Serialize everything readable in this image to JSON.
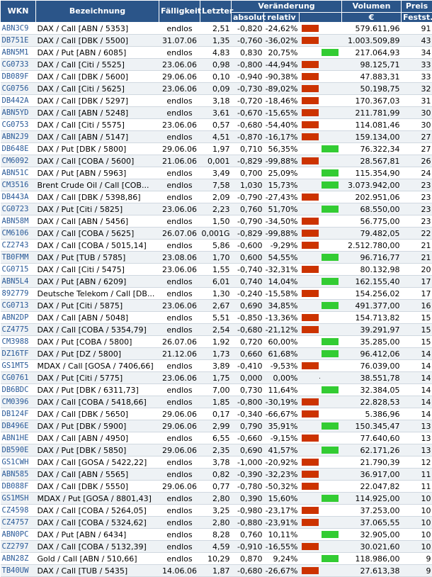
{
  "header": {
    "wkn": "WKN",
    "bezeichnung": "Bezeichnung",
    "faelligkeit": "Fälligkeit",
    "letzter": "Letzter",
    "veraenderung": "Veränderung",
    "absolut": "absolut",
    "relativ": "relativ",
    "volumen": "Volumen",
    "volumen_unit": "€",
    "preis": "Preis",
    "feststellungen": "Festst."
  },
  "colors": {
    "header_bg": "#2b5589",
    "negative_bar": "#cc3300",
    "positive_bar": "#33cc33",
    "link": "#2a5a98"
  },
  "rows": [
    {
      "wkn": "ABN3C9",
      "name": "DAX / Call [ABN / 5353]",
      "due": "endlos",
      "last": "2,51",
      "abs": "-0,820",
      "rel": "-24,62%",
      "dir": "neg",
      "vol": "579.611,96",
      "cnt": "91"
    },
    {
      "wkn": "DB751E",
      "name": "DAX / Call [DBK / 5500]",
      "due": "31.07.06",
      "last": "1,35",
      "abs": "-0,760",
      "rel": "-36,02%",
      "dir": "neg",
      "vol": "1.003.509,89",
      "cnt": "43"
    },
    {
      "wkn": "ABN5M1",
      "name": "DAX / Put [ABN / 6085]",
      "due": "endlos",
      "last": "4,83",
      "abs": "0,830",
      "rel": "20,75%",
      "dir": "pos",
      "vol": "217.064,93",
      "cnt": "34"
    },
    {
      "wkn": "CG0733",
      "name": "DAX / Call [Citi / 5525]",
      "due": "23.06.06",
      "last": "0,98",
      "abs": "-0,800",
      "rel": "-44,94%",
      "dir": "neg",
      "vol": "98.125,71",
      "cnt": "33"
    },
    {
      "wkn": "DB089F",
      "name": "DAX / Call [DBK / 5600]",
      "due": "29.06.06",
      "last": "0,10",
      "abs": "-0,940",
      "rel": "-90,38%",
      "dir": "neg",
      "vol": "47.883,31",
      "cnt": "33"
    },
    {
      "wkn": "CG0756",
      "name": "DAX / Call [Citi / 5625]",
      "due": "23.06.06",
      "last": "0,09",
      "abs": "-0,730",
      "rel": "-89,02%",
      "dir": "neg",
      "vol": "50.198,75",
      "cnt": "32"
    },
    {
      "wkn": "DB442A",
      "name": "DAX / Call [DBK / 5297]",
      "due": "endlos",
      "last": "3,18",
      "abs": "-0,720",
      "rel": "-18,46%",
      "dir": "neg",
      "vol": "170.367,03",
      "cnt": "31"
    },
    {
      "wkn": "ABN5YD",
      "name": "DAX / Call [ABN / 5248]",
      "due": "endlos",
      "last": "3,61",
      "abs": "-0,670",
      "rel": "-15,65%",
      "dir": "neg",
      "vol": "211.781,99",
      "cnt": "30"
    },
    {
      "wkn": "CG0753",
      "name": "DAX / Call [Citi / 5575]",
      "due": "23.06.06",
      "last": "0,57",
      "abs": "-0,680",
      "rel": "-54,40%",
      "dir": "neg",
      "vol": "114.081,46",
      "cnt": "30"
    },
    {
      "wkn": "ABN2J9",
      "name": "DAX / Call [ABN / 5147]",
      "due": "endlos",
      "last": "4,51",
      "abs": "-0,870",
      "rel": "-16,17%",
      "dir": "neg",
      "vol": "159.134,00",
      "cnt": "27"
    },
    {
      "wkn": "DB648E",
      "name": "DAX / Put [DBK / 5800]",
      "due": "29.06.06",
      "last": "1,97",
      "abs": "0,710",
      "rel": "56,35%",
      "dir": "pos",
      "vol": "76.322,34",
      "cnt": "27"
    },
    {
      "wkn": "CM6092",
      "name": "DAX / Call [COBA / 5600]",
      "due": "21.06.06",
      "last": "0,001",
      "abs": "-0,829",
      "rel": "-99,88%",
      "dir": "neg",
      "vol": "28.567,81",
      "cnt": "26"
    },
    {
      "wkn": "ABN51C",
      "name": "DAX / Put [ABN / 5963]",
      "due": "endlos",
      "last": "3,49",
      "abs": "0,700",
      "rel": "25,09%",
      "dir": "pos",
      "vol": "115.354,90",
      "cnt": "24"
    },
    {
      "wkn": "CM3516",
      "name": "Brent Crude Oil / Call [COB...",
      "due": "endlos",
      "last": "7,58",
      "abs": "1,030",
      "rel": "15,73%",
      "dir": "pos",
      "vol": "3.073.942,00",
      "cnt": "23"
    },
    {
      "wkn": "DB443A",
      "name": "DAX / Call [DBK / 5398,86]",
      "due": "endlos",
      "last": "2,09",
      "abs": "-0,790",
      "rel": "-27,43%",
      "dir": "neg",
      "vol": "202.951,06",
      "cnt": "23"
    },
    {
      "wkn": "CG0723",
      "name": "DAX / Put [Citi / 5825]",
      "due": "23.06.06",
      "last": "2,23",
      "abs": "0,760",
      "rel": "51,70%",
      "dir": "pos",
      "vol": "68.550,00",
      "cnt": "23"
    },
    {
      "wkn": "ABN58M",
      "name": "DAX / Call [ABN / 5456]",
      "due": "endlos",
      "last": "1,50",
      "abs": "-0,790",
      "rel": "-34,50%",
      "dir": "neg",
      "vol": "56.775,00",
      "cnt": "23"
    },
    {
      "wkn": "CM6106",
      "name": "DAX / Call [COBA / 5625]",
      "due": "26.07.06",
      "last": "0,001G",
      "abs": "-0,829",
      "rel": "-99,88%",
      "dir": "neg",
      "vol": "79.482,05",
      "cnt": "22"
    },
    {
      "wkn": "CZ2743",
      "name": "DAX / Call [COBA / 5015,14]",
      "due": "endlos",
      "last": "5,86",
      "abs": "-0,600",
      "rel": "-9,29%",
      "dir": "neg",
      "vol": "2.512.780,00",
      "cnt": "21"
    },
    {
      "wkn": "TB0FMM",
      "name": "DAX / Put [TUB / 5785]",
      "due": "23.08.06",
      "last": "1,70",
      "abs": "0,600",
      "rel": "54,55%",
      "dir": "pos",
      "vol": "96.716,77",
      "cnt": "21"
    },
    {
      "wkn": "CG0715",
      "name": "DAX / Call [Citi / 5475]",
      "due": "23.06.06",
      "last": "1,55",
      "abs": "-0,740",
      "rel": "-32,31%",
      "dir": "neg",
      "vol": "80.132,98",
      "cnt": "20"
    },
    {
      "wkn": "ABN5L4",
      "name": "DAX / Put [ABN / 6209]",
      "due": "endlos",
      "last": "6,01",
      "abs": "0,740",
      "rel": "14,04%",
      "dir": "pos",
      "vol": "162.155,40",
      "cnt": "17"
    },
    {
      "wkn": "892779",
      "name": "Deutsche Telekom / Call [DB...",
      "due": "endlos",
      "last": "1,30",
      "abs": "-0,240",
      "rel": "-15,58%",
      "dir": "neg",
      "vol": "154.256,02",
      "cnt": "17"
    },
    {
      "wkn": "CG0713",
      "name": "DAX / Put [Citi / 5875]",
      "due": "23.06.06",
      "last": "2,67",
      "abs": "0,690",
      "rel": "34,85%",
      "dir": "pos",
      "vol": "491.377,00",
      "cnt": "16"
    },
    {
      "wkn": "ABN2DP",
      "name": "DAX / Call [ABN / 5048]",
      "due": "endlos",
      "last": "5,51",
      "abs": "-0,850",
      "rel": "-13,36%",
      "dir": "neg",
      "vol": "154.713,82",
      "cnt": "15"
    },
    {
      "wkn": "CZ4775",
      "name": "DAX / Call [COBA / 5354,79]",
      "due": "endlos",
      "last": "2,54",
      "abs": "-0,680",
      "rel": "-21,12%",
      "dir": "neg",
      "vol": "39.291,97",
      "cnt": "15"
    },
    {
      "wkn": "CM3988",
      "name": "DAX / Put [COBA / 5800]",
      "due": "26.07.06",
      "last": "1,92",
      "abs": "0,720",
      "rel": "60,00%",
      "dir": "pos",
      "vol": "35.285,00",
      "cnt": "15"
    },
    {
      "wkn": "DZ16TF",
      "name": "DAX / Put [DZ / 5800]",
      "due": "21.12.06",
      "last": "1,73",
      "abs": "0,660",
      "rel": "61,68%",
      "dir": "pos",
      "vol": "96.412,06",
      "cnt": "14"
    },
    {
      "wkn": "GS1MT5",
      "name": "MDAX / Call [GOSA / 7406,66]",
      "due": "endlos",
      "last": "3,89",
      "abs": "-0,410",
      "rel": "-9,53%",
      "dir": "neg",
      "vol": "76.039,00",
      "cnt": "14"
    },
    {
      "wkn": "CG0761",
      "name": "DAX / Put [Citi / 5775]",
      "due": "23.06.06",
      "last": "1,75",
      "abs": "0,000",
      "rel": "0,00%",
      "dir": "zero",
      "vol": "38.551,78",
      "cnt": "14"
    },
    {
      "wkn": "DB6BDC",
      "name": "DAX / Put [DBK / 6311,73]",
      "due": "endlos",
      "last": "7,00",
      "abs": "0,730",
      "rel": "11,64%",
      "dir": "pos",
      "vol": "32.384,05",
      "cnt": "14"
    },
    {
      "wkn": "CM0396",
      "name": "DAX / Call [COBA / 5418,66]",
      "due": "endlos",
      "last": "1,85",
      "abs": "-0,800",
      "rel": "-30,19%",
      "dir": "neg",
      "vol": "22.828,53",
      "cnt": "14"
    },
    {
      "wkn": "DB124F",
      "name": "DAX / Call [DBK / 5650]",
      "due": "29.06.06",
      "last": "0,17",
      "abs": "-0,340",
      "rel": "-66,67%",
      "dir": "neg",
      "vol": "5.386,96",
      "cnt": "14"
    },
    {
      "wkn": "DB496E",
      "name": "DAX / Put [DBK / 5900]",
      "due": "29.06.06",
      "last": "2,99",
      "abs": "0,790",
      "rel": "35,91%",
      "dir": "pos",
      "vol": "150.345,47",
      "cnt": "13"
    },
    {
      "wkn": "ABN1HE",
      "name": "DAX / Call [ABN / 4950]",
      "due": "endlos",
      "last": "6,55",
      "abs": "-0,660",
      "rel": "-9,15%",
      "dir": "neg",
      "vol": "77.640,60",
      "cnt": "13"
    },
    {
      "wkn": "DB590E",
      "name": "DAX / Put [DBK / 5850]",
      "due": "29.06.06",
      "last": "2,35",
      "abs": "0,690",
      "rel": "41,57%",
      "dir": "pos",
      "vol": "62.171,26",
      "cnt": "13"
    },
    {
      "wkn": "GS1CWH",
      "name": "DAX / Call [GOSA / 5422,22]",
      "due": "endlos",
      "last": "3,78",
      "abs": "-1,000",
      "rel": "-20,92%",
      "dir": "neg",
      "vol": "21.790,39",
      "cnt": "12"
    },
    {
      "wkn": "ABN585",
      "name": "DAX / Call [ABN / 5565]",
      "due": "endlos",
      "last": "0,82",
      "abs": "-0,390",
      "rel": "-32,23%",
      "dir": "neg",
      "vol": "36.917,00",
      "cnt": "11"
    },
    {
      "wkn": "DB088F",
      "name": "DAX / Call [DBK / 5550]",
      "due": "29.06.06",
      "last": "0,77",
      "abs": "-0,780",
      "rel": "-50,32%",
      "dir": "neg",
      "vol": "22.047,82",
      "cnt": "11"
    },
    {
      "wkn": "GS1MSH",
      "name": "MDAX / Put [GOSA / 8801,43]",
      "due": "endlos",
      "last": "2,80",
      "abs": "0,390",
      "rel": "15,60%",
      "dir": "pos",
      "vol": "114.925,00",
      "cnt": "10"
    },
    {
      "wkn": "CZ4598",
      "name": "DAX / Call [COBA / 5264,05]",
      "due": "endlos",
      "last": "3,25",
      "abs": "-0,980",
      "rel": "-23,17%",
      "dir": "neg",
      "vol": "37.253,00",
      "cnt": "10"
    },
    {
      "wkn": "CZ4757",
      "name": "DAX / Call [COBA / 5324,62]",
      "due": "endlos",
      "last": "2,80",
      "abs": "-0,880",
      "rel": "-23,91%",
      "dir": "neg",
      "vol": "37.065,55",
      "cnt": "10"
    },
    {
      "wkn": "ABN0PC",
      "name": "DAX / Put [ABN / 6434]",
      "due": "endlos",
      "last": "8,28",
      "abs": "0,760",
      "rel": "10,11%",
      "dir": "pos",
      "vol": "32.905,00",
      "cnt": "10"
    },
    {
      "wkn": "CZ2797",
      "name": "DAX / Call [COBA / 5132,39]",
      "due": "endlos",
      "last": "4,59",
      "abs": "-0,910",
      "rel": "-16,55%",
      "dir": "neg",
      "vol": "30.021,60",
      "cnt": "10"
    },
    {
      "wkn": "ABN28Z",
      "name": "Gold / Call [ABN / 510,66]",
      "due": "endlos",
      "last": "10,29",
      "abs": "0,870",
      "rel": "9,24%",
      "dir": "pos",
      "vol": "118.986,00",
      "cnt": "9"
    },
    {
      "wkn": "TB40UW",
      "name": "DAX / Call [TUB / 5435]",
      "due": "14.06.06",
      "last": "1,87",
      "abs": "-0,680",
      "rel": "-26,67%",
      "dir": "neg",
      "vol": "27.613,38",
      "cnt": "9"
    }
  ]
}
